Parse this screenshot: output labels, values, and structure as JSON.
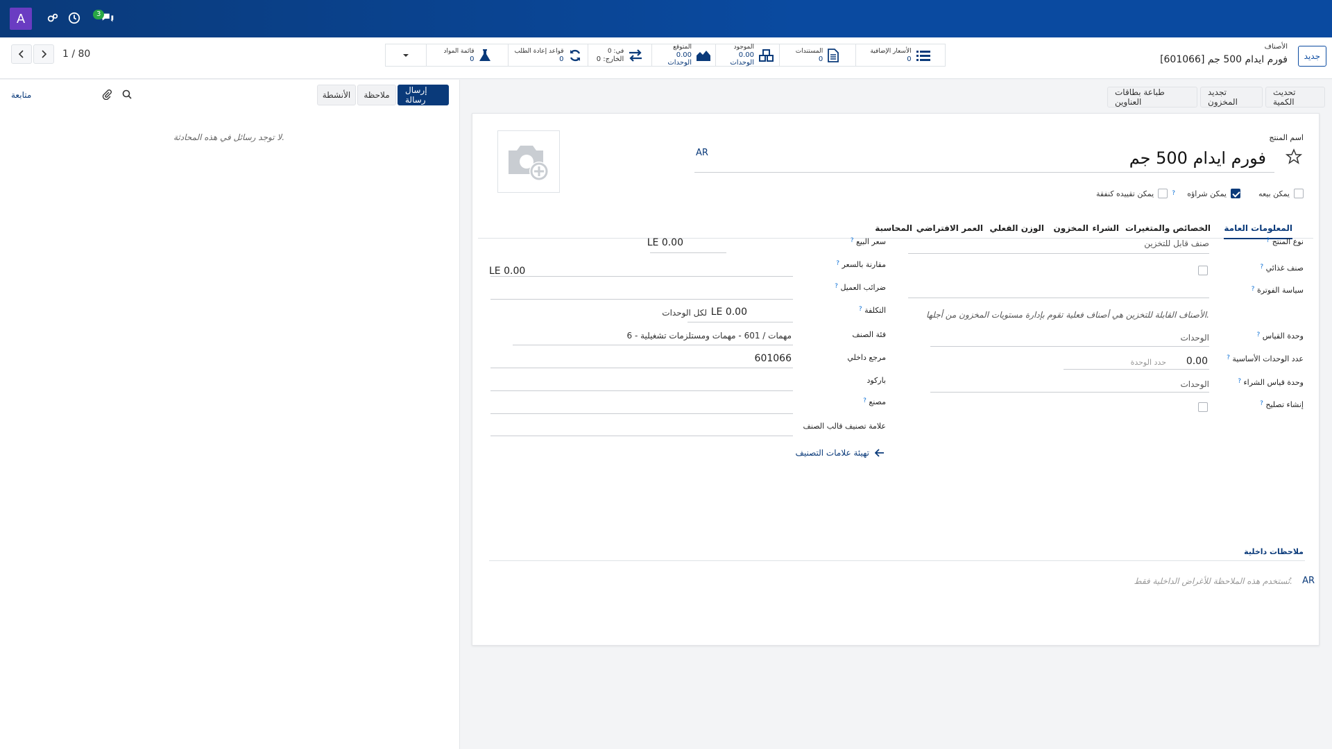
{
  "navbar": {
    "avatar_letter": "A",
    "chat_badge": "3"
  },
  "pager": {
    "text": "1 / 80"
  },
  "smart_buttons": [
    {
      "label": "قائمة المواد",
      "value": "0"
    },
    {
      "label": "قواعد إعادة الطلب",
      "value": "0"
    },
    {
      "label": "في: 0",
      "value": "الخارج: 0"
    },
    {
      "label": "المتوقع",
      "value": "0.00 الوحدات"
    },
    {
      "label": "الموجود",
      "value": "0.00 الوحدات"
    },
    {
      "label": "المستندات",
      "value": "0"
    },
    {
      "label": "الأسعار الإضافية",
      "value": "0"
    }
  ],
  "breadcrumb": {
    "parent": "الأصناف",
    "current": "[601066] فورم ايدام 500 جم"
  },
  "new_button": "جديد",
  "chatter": {
    "send_message": "إرسال رسالة",
    "log_note": "ملاحظة",
    "activities": "الأنشطة",
    "follow": "متابعة",
    "empty": "لا توجد رسائل في هذه المحادثة."
  },
  "actions": {
    "update_qty": "تحديث الكمية",
    "replenish": "تجديد المخزون",
    "print_labels": "طباعة بطاقات العناوين"
  },
  "product": {
    "name_label": "اسم المنتج",
    "name": "فورم ايدام 500 جم",
    "lang": "AR",
    "can_be_sold": "يمكن بيعه",
    "can_be_purchased": "يمكن شراؤه",
    "can_be_expensed": "يمكن تقييده كنفقة"
  },
  "tabs": [
    "المعلومات العامة",
    "الخصائص والمتغيرات",
    "الشراء",
    "المخزون",
    "الوزن الفعلي",
    "العمر الافتراضي",
    "المحاسبة"
  ],
  "left_fields": {
    "product_type_label": "نوع المنتج",
    "product_type": "صنف قابل للتخزين",
    "food_label": "صنف غذائي",
    "invoice_policy_label": "سياسة الفوترة",
    "storable_help": "الأصناف القابلة للتخزين هي أصناف فعلية تقوم بإدارة مستويات المخزون من أجلها.",
    "uom_label": "وحدة القياس",
    "uom": "الوحدات",
    "base_units_label": "عدد الوحدات الأساسية",
    "base_units": "0.00",
    "base_units_placeholder": "حدد الوحدة",
    "purchase_uom_label": "وحدة قياس الشراء",
    "purchase_uom": "الوحدات",
    "create_repair_label": "إنشاء تصليح"
  },
  "right_fields": {
    "sales_price_label": "سعر البيع",
    "sales_price": "LE 0.00",
    "compare_price_label": "مقارنة بالسعر",
    "compare_price": "LE 0.00",
    "customer_taxes_label": "ضرائب العميل",
    "cost_label": "التكلفة",
    "cost": "LE 0.00",
    "cost_suffix": "لكل الوحدات",
    "category_label": "فئة الصنف",
    "category": "6 - مهمات / 601 - مهمات ومستلزمات تشغيلية",
    "internal_ref_label": "مرجع داخلي",
    "internal_ref": "601066",
    "barcode_label": "باركود",
    "manufacturer_label": "مصنع",
    "template_tag_label": "علامة تصنيف قالب الصنف",
    "config_tags_link": "تهيئة علامات التصنيف"
  },
  "internal_notes": {
    "label": "ملاحظات داخلية",
    "lang": "AR",
    "placeholder": "تُستخدم هذه الملاحظة للأغراض الداخلية فقط."
  }
}
